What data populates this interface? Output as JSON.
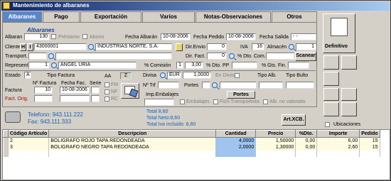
{
  "window": {
    "title": "Mantenimiento de albaranes"
  },
  "tabs": [
    "Albaranes",
    "Pago",
    "Exportación",
    "Varios",
    "Notas-Observaciones",
    "Otros"
  ],
  "section_title": "Albaranes",
  "header": {
    "albaran_label": "Albaran",
    "albaran_value": "130",
    "prestamo_label": "Préstamo",
    "abono_label": "Abono",
    "fecha_albaran_label": "Fecha Albarán",
    "fecha_albaran_value": "10-08-2006",
    "fecha_pedido_label": "Fecha Pedido",
    "fecha_pedido_value": "10-08-2006",
    "fecha_salida_label": "Fecha Salida",
    "fecha_salida_value": "- -",
    "cliente_label": "Cliente",
    "cliente_h": "H",
    "cliente_i": "I",
    "cliente_code": "43000001",
    "cliente_name": "INDUSTRIAS NORTE, S.A.",
    "dir_envio_label": "Dir.Envio",
    "dir_envio_value": "0",
    "iva_label": "IVA",
    "iva_value": "16",
    "almacen_label": "Almacén",
    "almacen_value": "1",
    "transport_label": "Transport.",
    "dir_fact_label": "Dir. Fact.",
    "dir_fact_value": "0",
    "dto_com_label": "% Dto. Com.",
    "scanear_label": "Scanear",
    "represent_label": "Represent.",
    "represent_code": "1",
    "represent_name": "ANGEL URIA",
    "comision_label": "% Comisión",
    "comision_value": "1",
    "comision_pct": "3,00",
    "dto_pp_label": "% Dto. PP",
    "gts_fin_label": "% Gts. Fin."
  },
  "lower": {
    "estado_label": "Estado",
    "estado_value": "A",
    "tipo_factura_label": "Tipo Factura",
    "n_factura_label": "Nº Factura",
    "fecha_fac_label": "Fecha Fac.",
    "serie_label": "Serie",
    "factura_label": "Factura",
    "factura_value": "10",
    "fecha_fac_value": "10-08-2006",
    "fact_orig_label": "Fact. Orig.",
    "aa_label": "AA",
    "aa_value": "Z",
    "fm_label": "FM",
    "nf_label": "NF",
    "rc_label": "RC",
    "divisa_label": "Divisa",
    "divisa_value": "EUR",
    "divisa_rate": "1,0000",
    "en_divisa_label": "En Divisa",
    "tipo_alb_label": "Tipo Alb.",
    "tipo_bulto_label": "Tipo Bulto",
    "n_trf_label": "Nº Trf",
    "portes_label": "Portes",
    "imp_embalajes_label": "Imp.Embalajes",
    "portes_button": "Portes",
    "embalajes_chk": "Embalajes",
    "fich_transportista_chk": "Fich.Transportista",
    "alb_no_valorado_chk": "Alb. no valorado"
  },
  "contact": {
    "telefono": "Telefono: 943.111.222",
    "fax": "Fax: 943.111.333"
  },
  "totals": {
    "total": "Total 8,60",
    "total_neto": "Total Neto:8,60",
    "total_iva": "Total Iva incluido: 8,60"
  },
  "art_xcb_label": "Art.XCB.",
  "right": {
    "definitivo_label": "Definitivo",
    "ubicaciones_label": "Ubicaciones"
  },
  "grid": {
    "columns": [
      "Código Artículo",
      "Descripcion",
      "Cantidad",
      "Precio",
      "%Dto.",
      "Importe",
      "Pedido"
    ],
    "rows": [
      [
        "2",
        "BOLIGRAFO ROJO TAPA REDONDEADA",
        "4,0000",
        "1,50000",
        "0,00",
        "6,00",
        "15"
      ],
      [
        "3",
        "BOLIGRAFO NEGRO TAPA REDONDEADA",
        "2,0000",
        "1,30000",
        "0,00",
        "2,60",
        "15"
      ]
    ]
  }
}
